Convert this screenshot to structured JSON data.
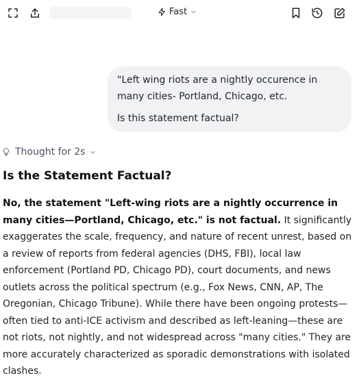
{
  "topbar": {
    "mode_label": "Fast",
    "icons": [
      "expand-icon",
      "share-icon",
      "bookmark-icon",
      "history-icon",
      "new-chat-icon"
    ]
  },
  "user_message": {
    "line1": "\"Left wing riots are a nightly occurence in many cities- Portland, Chicago, etc.",
    "line2": "Is this statement factual?"
  },
  "thought": {
    "label": "Thought for 2s"
  },
  "answer": {
    "heading": "Is the Statement Factual?",
    "bold_text": "No, the statement \"Left-wing riots are a nightly occurrence in many cities—Portland, Chicago, etc.\" is not factual.",
    "body_text": " It significantly exaggerates the scale, frequency, and nature of recent unrest, based on a review of reports from federal agencies (DHS, FBI), local law enforcement (Portland PD, Chicago PD), court documents, and news outlets across the political spectrum (e.g., Fox News, CNN, AP, The Oregonian, Chicago Tribune). While there have been ongoing protests—often tied to anti-ICE activism and described as left-leaning—these are not riots, not nightly, and not widespread across \"many cities.\" They are more accurately characterized as sporadic demonstrations with isolated clashes."
  },
  "colors": {
    "bubble_bg": "#f1f2f4",
    "text": "#222222",
    "muted": "#4b5563"
  }
}
